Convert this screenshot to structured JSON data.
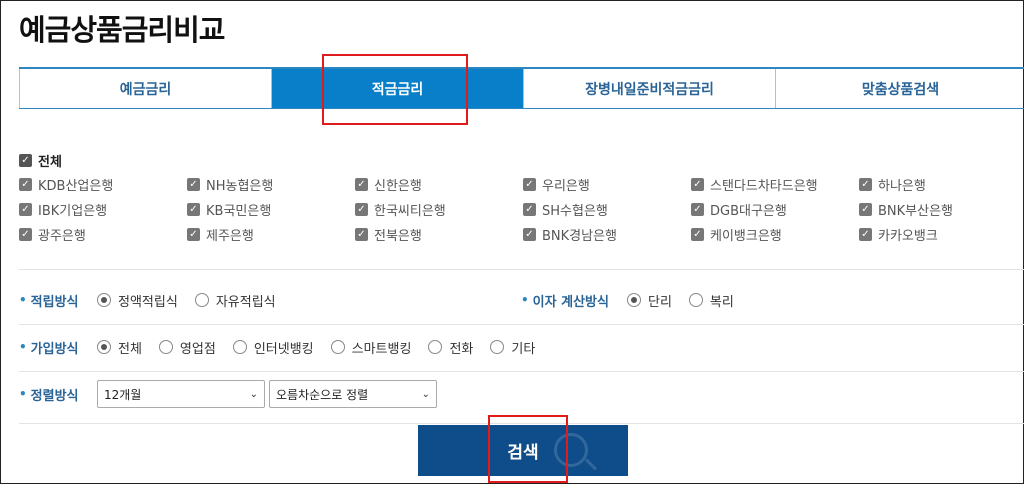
{
  "page_title": "예금상품금리비교",
  "tabs": [
    {
      "label": "예금금리",
      "active": false
    },
    {
      "label": "적금금리",
      "active": true
    },
    {
      "label": "장병내일준비적금금리",
      "active": false
    },
    {
      "label": "맞춤상품검색",
      "active": false
    }
  ],
  "banks": {
    "all_label": "전체",
    "items": [
      "KDB산업은행",
      "NH농협은행",
      "신한은행",
      "우리은행",
      "스탠다드차타드은행",
      "하나은행",
      "IBK기업은행",
      "KB국민은행",
      "한국씨티은행",
      "SH수협은행",
      "DGB대구은행",
      "BNK부산은행",
      "광주은행",
      "제주은행",
      "전북은행",
      "BNK경남은행",
      "케이뱅크은행",
      "카카오뱅크"
    ]
  },
  "savings_method": {
    "label": "적립방식",
    "options": [
      "정액적립식",
      "자유적립식"
    ],
    "selected": "정액적립식"
  },
  "interest_method": {
    "label": "이자 계산방식",
    "options": [
      "단리",
      "복리"
    ],
    "selected": "단리"
  },
  "join_method": {
    "label": "가입방식",
    "options": [
      "전체",
      "영업점",
      "인터넷뱅킹",
      "스마트뱅킹",
      "전화",
      "기타"
    ],
    "selected": "전체"
  },
  "sort_method": {
    "label": "정렬방식",
    "period_value": "12개월",
    "order_value": "오름차순으로 정렬"
  },
  "search_button_label": "검색",
  "colors": {
    "accent": "#0a7fc9",
    "button": "#0f4d8a",
    "highlight": "#e01b1b"
  }
}
